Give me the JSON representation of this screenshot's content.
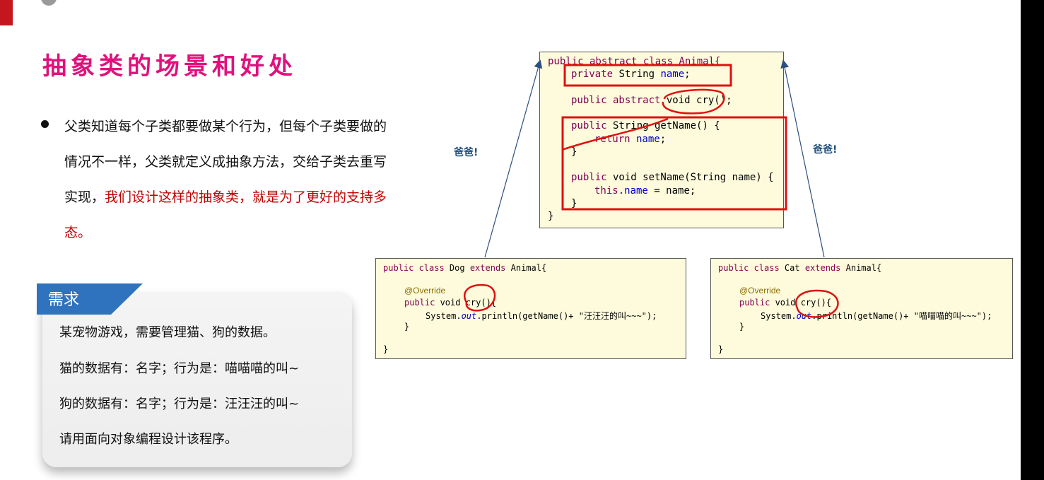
{
  "slide": {
    "title": "抽象类的场景和好处",
    "bullet": {
      "text_part1": "父类知道每个子类都要做某个行为，但每个子类要做的情况不一样，父类就定义成抽象方法，交给子类去重写实现，",
      "text_highlight": "我们设计这样的抽象类，就是为了更好的支持多态。"
    },
    "demand": {
      "tag": "需求",
      "lines": [
        "某宠物游戏，需要管理猫、狗的数据。",
        "猫的数据有：名字；行为是：喵喵喵的叫~",
        "狗的数据有：名字；行为是：汪汪汪的叫~",
        "请用面向对象编程设计该程序。"
      ]
    },
    "arrow_labels": {
      "left": "爸爸!",
      "right": "爸爸!"
    }
  },
  "code": {
    "parent": {
      "l1": "public abstract class Animal{",
      "l2_kw": "private",
      "l2_type": " String ",
      "l2_field": "name",
      "l2_end": ";",
      "l3_kw": "public abstract",
      "l3_rest": " void cry();",
      "l4_kw": "public",
      "l4_rest": " String getName() {",
      "l5_kw": "return",
      "l5_field": " name",
      "l5_end": ";",
      "l6": "}",
      "l7_kw": "public",
      "l7_rest": " void setName(String name) {",
      "l8_kw": "this",
      "l8_field": ".name",
      "l8_rest": " = name;",
      "l9": "}",
      "l10": "}"
    },
    "dog": {
      "l1_kw": "public class",
      "l1_name": " Dog ",
      "l1_kw2": "extends",
      "l1_rest": " Animal{",
      "l2": "@Override",
      "l3_kw": "public",
      "l3_rest": " void cry(){",
      "l4_a": "System.",
      "l4_it": "out",
      "l4_b": ".println(getName()+ ",
      "l4_str": "\"汪汪汪的叫~~~\"",
      "l4_end": ");",
      "l5": "}",
      "l6": "}"
    },
    "cat": {
      "l1_kw": "public class",
      "l1_name": " Cat ",
      "l1_kw2": "extends",
      "l1_rest": " Animal{",
      "l2": "@Override",
      "l3_kw": "public",
      "l3_rest": " void cry(){",
      "l4_a": "System.",
      "l4_it": "out",
      "l4_b": ".println(getName()+ ",
      "l4_str": "\"喵喵喵的叫~~~\"",
      "l4_end": ");",
      "l5": "}",
      "l6": "}"
    }
  },
  "colors": {
    "title": "#e0117c",
    "highlight": "#c00000",
    "tag": "#2f73bf",
    "annotation": "#e01010"
  }
}
